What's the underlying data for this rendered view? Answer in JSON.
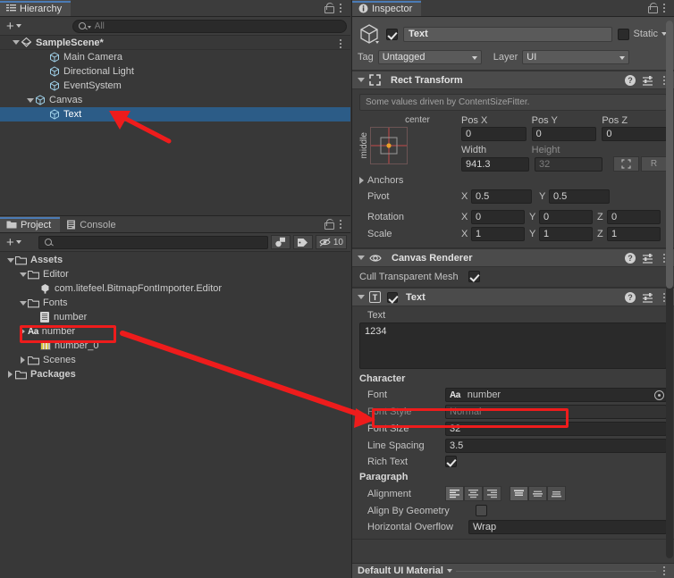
{
  "hierarchy": {
    "tab_label": "Hierarchy",
    "search_placeholder": "All",
    "add_label": "+",
    "rows": [
      {
        "label": "SampleScene*",
        "icon": "scene-icon",
        "depth": 0,
        "foldout": "open",
        "selected": false,
        "menu": true
      },
      {
        "label": "Main Camera",
        "icon": "gameobject-icon",
        "depth": 2,
        "foldout": "none",
        "selected": false,
        "menu": false
      },
      {
        "label": "Directional Light",
        "icon": "gameobject-icon",
        "depth": 2,
        "foldout": "none",
        "selected": false,
        "menu": false
      },
      {
        "label": "EventSystem",
        "icon": "gameobject-icon",
        "depth": 2,
        "foldout": "none",
        "selected": false,
        "menu": false
      },
      {
        "label": "Canvas",
        "icon": "gameobject-icon",
        "depth": 1,
        "foldout": "open",
        "selected": false,
        "menu": false
      },
      {
        "label": "Text",
        "icon": "gameobject-icon",
        "depth": 2,
        "foldout": "none",
        "selected": true,
        "menu": false
      }
    ]
  },
  "project": {
    "tab_label": "Project",
    "console_tab_label": "Console",
    "add_label": "+",
    "search_placeholder": "",
    "hidden_count": "10",
    "rows": [
      {
        "label": "Assets",
        "icon": "folder-icon",
        "depth": 0,
        "foldout": "open",
        "bold": true
      },
      {
        "label": "Editor",
        "icon": "folder-icon",
        "depth": 1,
        "foldout": "open",
        "bold": false
      },
      {
        "label": "com.litefeel.BitmapFontImporter.Editor",
        "icon": "asmdef-icon",
        "depth": 2,
        "foldout": "none",
        "bold": false
      },
      {
        "label": "Fonts",
        "icon": "folder-icon",
        "depth": 1,
        "foldout": "open",
        "bold": false
      },
      {
        "label": "number",
        "icon": "textasset-icon",
        "depth": 2,
        "foldout": "none",
        "bold": false
      },
      {
        "label": "number",
        "icon": "font-icon",
        "depth": 1,
        "foldout": "closed",
        "bold": false,
        "highlight": true
      },
      {
        "label": "number_0",
        "icon": "texture-icon",
        "depth": 2,
        "foldout": "none",
        "bold": false
      },
      {
        "label": "Scenes",
        "icon": "folder-icon",
        "depth": 1,
        "foldout": "closed",
        "bold": false
      },
      {
        "label": "Packages",
        "icon": "folder-icon",
        "depth": 0,
        "foldout": "closed",
        "bold": true
      }
    ]
  },
  "inspector": {
    "tab_label": "Inspector",
    "gameobject": {
      "enabled": true,
      "name": "Text",
      "static_label": "Static",
      "static_checked": false,
      "tag_label": "Tag",
      "tag_value": "Untagged",
      "layer_label": "Layer",
      "layer_value": "UI"
    },
    "rect_transform": {
      "title": "Rect Transform",
      "driven_note": "Some values driven by ContentSizeFitter.",
      "anchor_preset_h": "center",
      "anchor_preset_v": "middle",
      "pos_x_label": "Pos X",
      "pos_x": "0",
      "pos_y_label": "Pos Y",
      "pos_y": "0",
      "pos_z_label": "Pos Z",
      "pos_z": "0",
      "width_label": "Width",
      "width": "941.3",
      "height_label": "Height",
      "height": "32",
      "blueprint_label": "",
      "raw_label": "R",
      "anchors_label": "Anchors",
      "pivot_label": "Pivot",
      "pivot_x": "0.5",
      "pivot_y": "0.5",
      "rotation_label": "Rotation",
      "rot_x": "0",
      "rot_y": "0",
      "rot_z": "0",
      "scale_label": "Scale",
      "scale_x": "1",
      "scale_y": "1",
      "scale_z": "1"
    },
    "canvas_renderer": {
      "title": "Canvas Renderer",
      "cull_label": "Cull Transparent Mesh",
      "cull_checked": true
    },
    "text_component": {
      "title": "Text",
      "enabled": true,
      "text_label": "Text",
      "text_value": "1234",
      "character_label": "Character",
      "font_label": "Font",
      "font_value": "number",
      "font_style_label": "Font Style",
      "font_style_value": "Normal",
      "font_size_label": "Font Size",
      "font_size_value": "32",
      "line_spacing_label": "Line Spacing",
      "line_spacing_value": "3.5",
      "rich_text_label": "Rich Text",
      "rich_text_checked": true,
      "paragraph_label": "Paragraph",
      "alignment_label": "Alignment",
      "align_h_selected": 0,
      "align_v_selected": 0,
      "align_by_geometry_label": "Align By Geometry",
      "align_by_geometry_checked": false,
      "horizontal_overflow_label": "Horizontal Overflow",
      "horizontal_overflow_value": "Wrap"
    },
    "material_bar": {
      "title": "Default UI Material"
    }
  },
  "annotations": {
    "highlight_color": "#ee1c1c",
    "arrows": [
      {
        "name": "arrow-to-text-row"
      },
      {
        "name": "arrow-font-asset-to-font-field"
      }
    ]
  }
}
